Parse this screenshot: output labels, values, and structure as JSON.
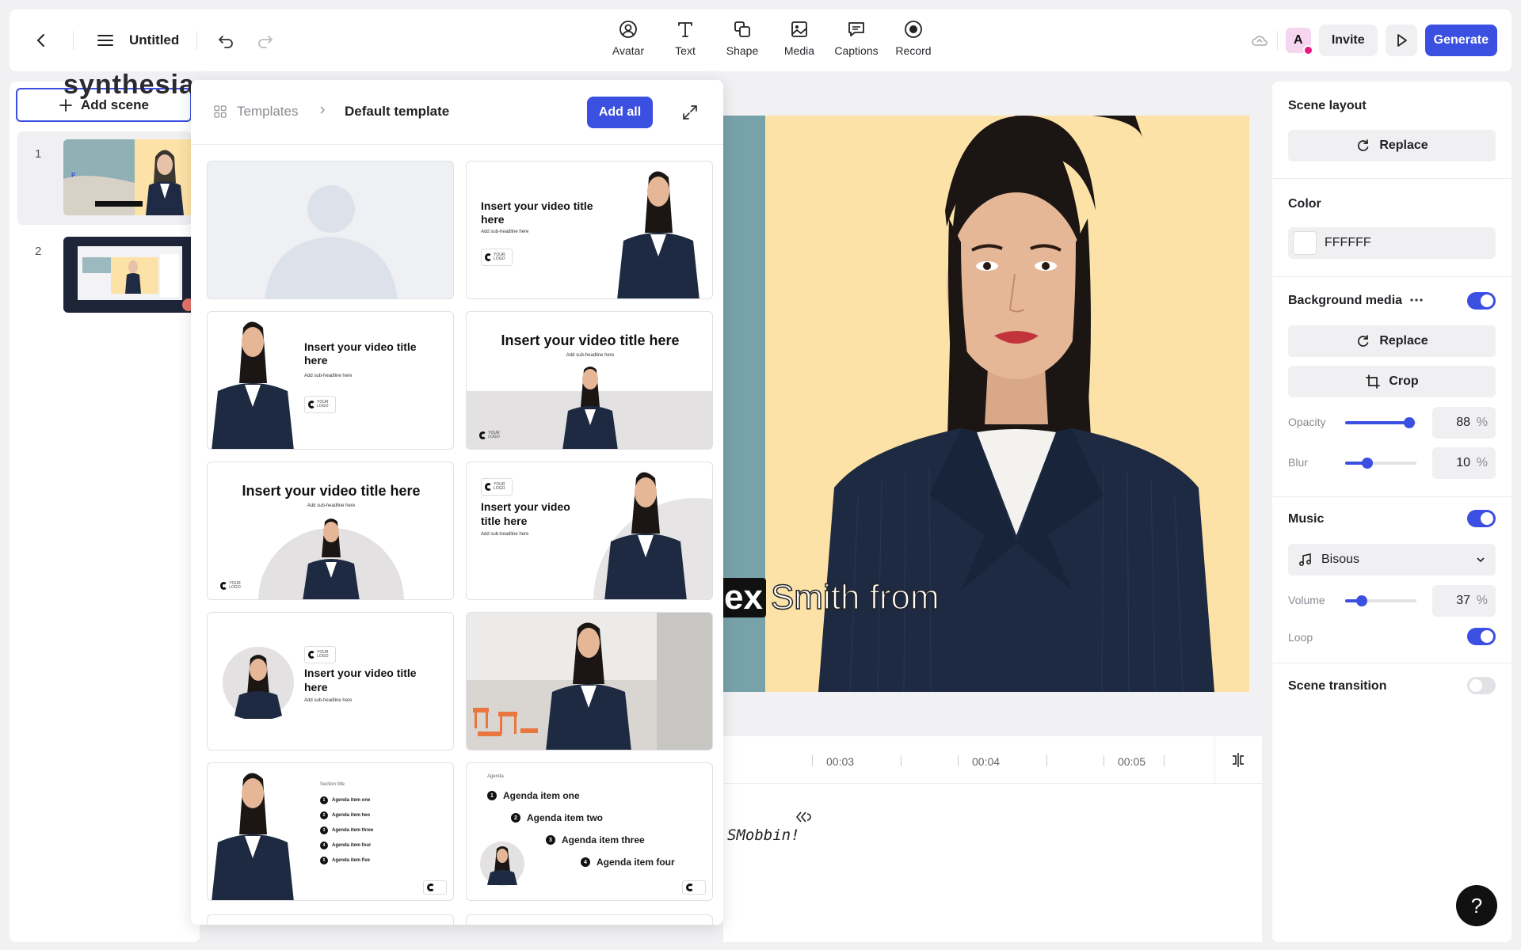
{
  "header": {
    "title": "Untitled",
    "tools": [
      {
        "label": "Avatar",
        "icon": "avatar-icon"
      },
      {
        "label": "Text",
        "icon": "text-icon"
      },
      {
        "label": "Shape",
        "icon": "shape-icon"
      },
      {
        "label": "Media",
        "icon": "media-icon"
      },
      {
        "label": "Captions",
        "icon": "captions-icon"
      },
      {
        "label": "Record",
        "icon": "record-icon"
      }
    ],
    "avatar_letter": "A",
    "invite_label": "Invite",
    "generate_label": "Generate"
  },
  "scenes": {
    "add_label": "Add scene",
    "items": [
      {
        "number": "1"
      },
      {
        "number": "2"
      }
    ]
  },
  "templates": {
    "crumb_root": "Templates",
    "crumb_current": "Default template",
    "add_all_label": "Add all",
    "title_text": "Insert your video title here",
    "title_two_line_a": "Insert your video title",
    "title_two_line_b": "here",
    "title_three_a": "Insert your video",
    "title_three_b": "title here",
    "sub_text": "Add sub-headline here",
    "logo_text": "YOUR LOGO",
    "section_title": "Section title",
    "agenda_small": [
      "Agenda item one",
      "Agenda item two",
      "Agenda item three",
      "Agenda item four",
      "Agenda item five"
    ],
    "agenda_heading": "Agenda",
    "agenda_large": [
      "Agenda item one",
      "Agenda item two",
      "Agenda item three",
      "Agenda item four"
    ]
  },
  "canvas": {
    "caption_highlight": "ex",
    "caption_rest": "Smith from",
    "bg_color": "#fde2a7"
  },
  "timeline": {
    "labels": [
      "00:03",
      "00:04",
      "00:05"
    ],
    "script_text": "SMobbin!"
  },
  "properties": {
    "scene_layout_title": "Scene layout",
    "replace_label": "Replace",
    "color_title": "Color",
    "color_value": "FFFFFF",
    "bg_media_title": "Background media",
    "bg_media_enabled": true,
    "crop_label": "Crop",
    "opacity_label": "Opacity",
    "opacity_value": "88",
    "blur_label": "Blur",
    "blur_value": "10",
    "percent": "%",
    "music_title": "Music",
    "music_enabled": true,
    "music_track": "Bisous",
    "volume_label": "Volume",
    "volume_value": "37",
    "loop_label": "Loop",
    "loop_enabled": true,
    "transition_title": "Scene transition",
    "transition_enabled": false
  },
  "colors": {
    "accent": "#3b4fe0"
  },
  "help_label": "?"
}
